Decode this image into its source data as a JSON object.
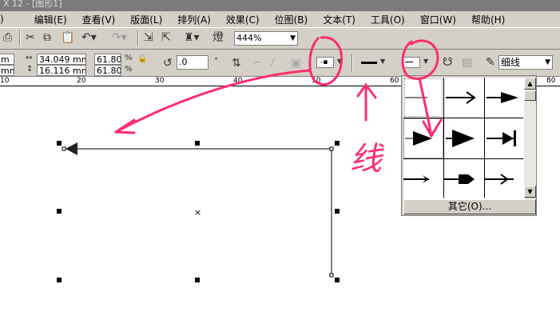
{
  "title": "X 12 - [图形1]",
  "menu": [
    "编辑(E)",
    "查看(V)",
    "版面(L)",
    "排列(A)",
    "效果(C)",
    "位图(B)",
    "文本(T)",
    "工具(O)",
    "窗口(W)",
    "帮助(H)"
  ],
  "toolbar": {
    "zoom": "444%"
  },
  "props": {
    "x_partial": "m",
    "y_partial": "mm",
    "width": "34.049 mm",
    "height": "16.116 mm",
    "scale_x": "61.80",
    "scale_y": "61.80",
    "pct": "%",
    "angle": ".0",
    "deg": "°",
    "line_width": "细线"
  },
  "ruler": [
    "10",
    "20",
    "30",
    "40",
    "50",
    "60",
    "80"
  ],
  "popup": {
    "other": "其它(O)..."
  },
  "annotation": {
    "text": "线",
    "color": "#ff2d6f"
  }
}
